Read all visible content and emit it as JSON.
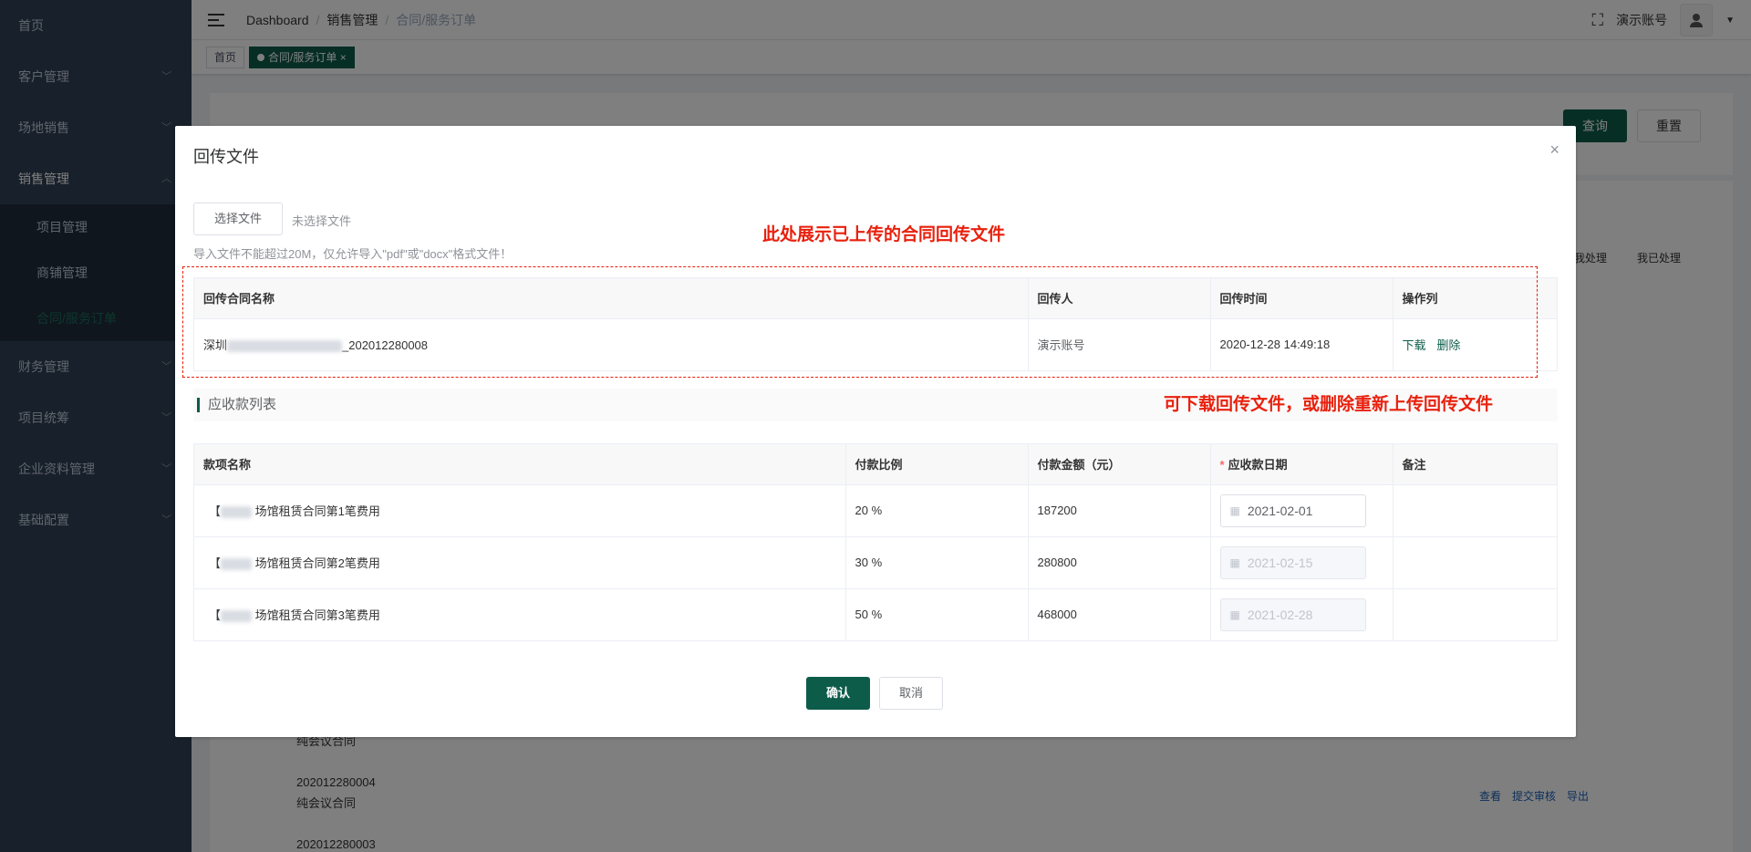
{
  "sidebar": {
    "items": [
      {
        "label": "首页",
        "has_arrow": false
      },
      {
        "label": "客户管理",
        "has_arrow": true
      },
      {
        "label": "场地销售",
        "has_arrow": true
      },
      {
        "label": "销售管理",
        "has_arrow": true,
        "expanded": true
      },
      {
        "label": "财务管理",
        "has_arrow": true
      },
      {
        "label": "项目统筹",
        "has_arrow": true
      },
      {
        "label": "企业资料管理",
        "has_arrow": true
      },
      {
        "label": "基础配置",
        "has_arrow": true
      }
    ],
    "sub_items": [
      "项目管理",
      "商铺管理",
      "合同/服务订单"
    ],
    "active_sub": "合同/服务订单"
  },
  "navbar": {
    "breadcrumb": [
      "Dashboard",
      "销售管理",
      "合同/服务订单"
    ],
    "account": "演示账号"
  },
  "tags": {
    "home": "首页",
    "active": "合同/服务订单",
    "close": "×"
  },
  "background": {
    "query_label": "查询",
    "reset_label": "重置",
    "tab_pending": "我处理",
    "tab_done": "我已处理",
    "rows": [
      {
        "code": "",
        "type": "纯会议合同"
      },
      {
        "code": "202012280004",
        "type": "纯会议合同"
      },
      {
        "code": "202012280003",
        "type": ""
      }
    ],
    "actions": [
      "查看",
      "提交审核",
      "导出"
    ]
  },
  "dialog": {
    "title": "回传文件",
    "close": "×",
    "choose_file": "选择文件",
    "no_file": "未选择文件",
    "hint": "导入文件不能超过20M，仅允许导入\"pdf\"或\"docx\"格式文件！",
    "annotation_top": "此处展示已上传的合同回传文件",
    "annotation_right": "可下载回传文件，或删除重新上传回传文件",
    "uploads": {
      "headers": [
        "回传合同名称",
        "回传人",
        "回传时间",
        "操作列"
      ],
      "rows": [
        {
          "name_prefix": "深圳",
          "name_suffix": "_202012280008",
          "uploader": "演示账号",
          "time": "2020-12-28 14:49:18",
          "download": "下载",
          "delete": "删除"
        }
      ]
    },
    "receivables_title": "应收款列表",
    "receivables": {
      "headers": [
        "款项名称",
        "付款比例",
        "付款金额（元）",
        "应收款日期",
        "备注"
      ],
      "rows": [
        {
          "name": "场馆租赁合同第1笔费用",
          "ratio": "20 %",
          "amount": "187200",
          "date": "2021-02-01",
          "disabled": false,
          "remark": ""
        },
        {
          "name": "场馆租赁合同第2笔费用",
          "ratio": "30 %",
          "amount": "280800",
          "date": "2021-02-15",
          "disabled": true,
          "remark": ""
        },
        {
          "name": "场馆租赁合同第3笔费用",
          "ratio": "50 %",
          "amount": "468000",
          "date": "2021-02-28",
          "disabled": true,
          "remark": ""
        }
      ]
    },
    "confirm": "确认",
    "cancel": "取消"
  }
}
